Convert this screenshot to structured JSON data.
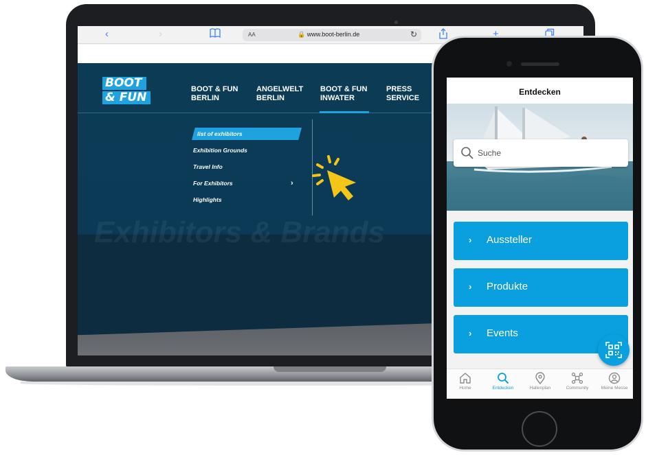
{
  "laptop": {
    "browser": {
      "url_prefix": "AA",
      "url": "www.boot-berlin.de",
      "icons": [
        "back-icon",
        "forward-icon",
        "bookmarks-icon",
        "lock-icon",
        "reload-icon",
        "share-icon",
        "new-tab-icon",
        "tabs-icon"
      ]
    },
    "site": {
      "logo": {
        "line1": "BOOT",
        "line2": "& FUN"
      },
      "nav": [
        {
          "line1": "BOOT & FUN",
          "line2": "BERLIN"
        },
        {
          "line1": "ANGELWELT",
          "line2": "BERLIN"
        },
        {
          "line1": "BOOT & FUN",
          "line2": "INWATER"
        },
        {
          "line1": "PRESS",
          "line2": "SERVICE"
        }
      ],
      "submenu": [
        {
          "label": "list of exhibitors"
        },
        {
          "label": "Exhibition Grounds"
        },
        {
          "label": "Travel Info"
        },
        {
          "label": "For Exhibitors"
        },
        {
          "label": "Highlights"
        }
      ],
      "background_heading": "Exhibitors & Brands"
    },
    "accent_color": "#1fa3e0",
    "cursor_color": "#f5c518"
  },
  "phone": {
    "title": "Entdecken",
    "search_placeholder": "Suche",
    "menu": [
      {
        "label": "Aussteller"
      },
      {
        "label": "Produkte"
      },
      {
        "label": "Events"
      }
    ],
    "qr_button": "qr-code-icon",
    "tabs": [
      {
        "label": "Home",
        "icon": "home-icon"
      },
      {
        "label": "Entdecken",
        "icon": "search-icon"
      },
      {
        "label": "Hallenplan",
        "icon": "map-pin-icon"
      },
      {
        "label": "Community",
        "icon": "network-icon"
      },
      {
        "label": "Meine Messe",
        "icon": "profile-icon"
      }
    ],
    "accent_color": "#0aa0e0"
  }
}
